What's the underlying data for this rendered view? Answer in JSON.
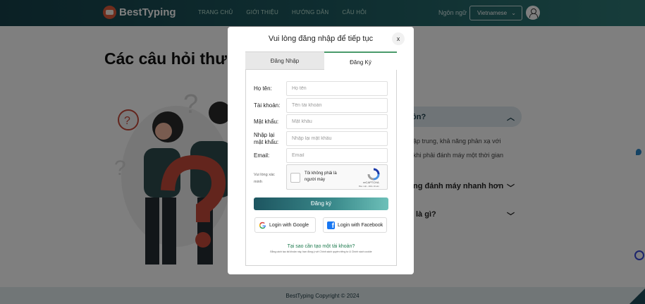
{
  "navbar": {
    "brand": "BestTyping",
    "links": [
      "Trang chủ",
      "Giới thiệu",
      "Hướng dẫn",
      "Câu hỏi"
    ],
    "language_label": "Ngôn ngữ",
    "language_value": "Vietnamese"
  },
  "page": {
    "title": "Các câu hỏi thư",
    "faq": {
      "q1": "ồn?",
      "a1_line1": "ập trung, khả năng phản xạ với",
      "a1_line2": "khi phải đánh máy một thời gian",
      "q2": "ng đánh máy nhanh hơn",
      "q3": "là gì?"
    }
  },
  "modal": {
    "title": "Vui lòng đăng nhập để tiếp tục",
    "close": "x",
    "tabs": {
      "login": "Đăng Nhập",
      "register": "Đăng Ký"
    },
    "fields": {
      "fullname": {
        "label": "Họ tên:",
        "placeholder": "Họ tên"
      },
      "username": {
        "label": "Tài khoản:",
        "placeholder": "Tên tài khoản"
      },
      "password": {
        "label": "Mật khẩu:",
        "placeholder": "Mật khẩu"
      },
      "confirm": {
        "label": "Nhập lại mật khẩu:",
        "placeholder": "Nhập lại mật khẩu"
      },
      "email": {
        "label": "Email:",
        "placeholder": "Email"
      }
    },
    "captcha": {
      "label": "Vui lòng xác minh",
      "text": "Tôi không phải là người máy",
      "brand": "reCAPTCHA",
      "terms": "Bảo mật - Điều khoản"
    },
    "submit": "Đăng ký",
    "google": "Login with Google",
    "facebook": "Login with Facebook",
    "why": "Tại sao cần tạo một tài khoản?",
    "terms": "Bằng cách tạo tài khoản này, bạn đồng ý với Chính sách quyền riêng tư & Chính sách cookie"
  },
  "footer": {
    "copyright": "BestTyping Copyright © 2024"
  },
  "colors": {
    "accent": "#1d5560",
    "link": "#1d7a4e"
  }
}
